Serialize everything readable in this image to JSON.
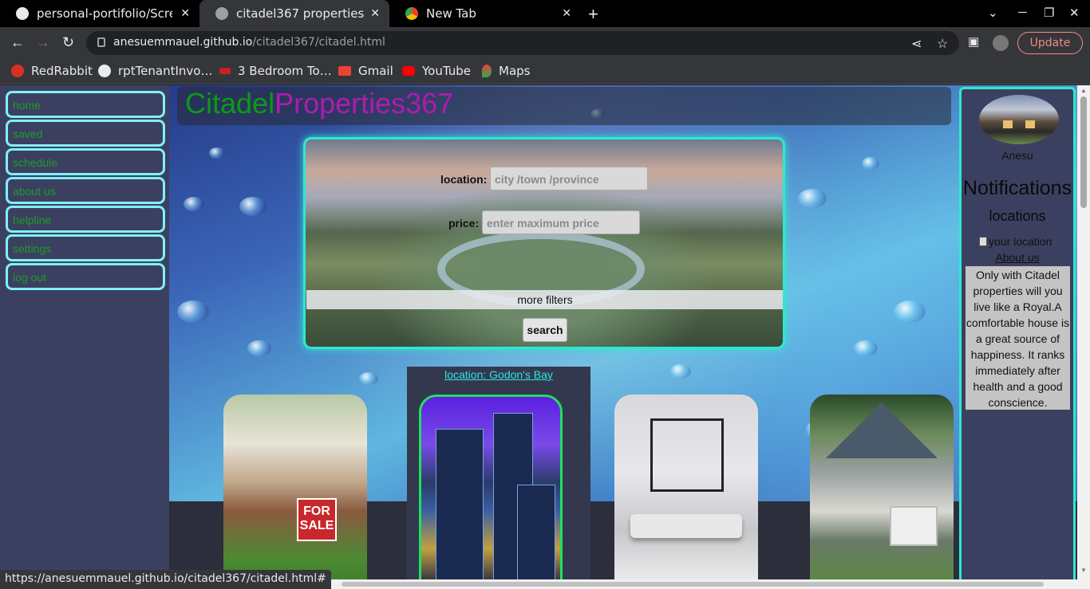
{
  "browser": {
    "tabs": [
      {
        "title": "personal-portifolio/Screen",
        "active": false,
        "icon": "github-icon"
      },
      {
        "title": "citadel367 properties",
        "active": true,
        "icon": "globe-icon"
      },
      {
        "title": "New Tab",
        "active": false,
        "icon": "chrome-icon"
      }
    ],
    "url_host": "anesuemmauel.github.io",
    "url_path": "/citadel367/citadel.html",
    "update_label": "Update",
    "bookmarks": [
      {
        "label": "RedRabbit",
        "icon": "redrabbit-icon",
        "color": "#d93025"
      },
      {
        "label": "rptTenantInvo…",
        "icon": "globe-icon",
        "color": "#e8eaed"
      },
      {
        "label": "3 Bedroom To…",
        "icon": "property-icon",
        "color": "#c5221f"
      },
      {
        "label": "Gmail",
        "icon": "gmail-icon",
        "color": "#ea4335"
      },
      {
        "label": "YouTube",
        "icon": "youtube-icon",
        "color": "#ff0000"
      },
      {
        "label": "Maps",
        "icon": "maps-icon",
        "color": "#34a853"
      }
    ],
    "status_url": "https://anesuemmauel.github.io/citadel367/citadel.html#"
  },
  "page": {
    "brand_part1": "Citadel",
    "brand_part2": "Properties367",
    "nav": [
      "home",
      "saved",
      "schedule",
      "about us",
      "helpline",
      "settings",
      "log out"
    ],
    "search": {
      "location_label": "location:",
      "location_placeholder": "city /town /province",
      "price_label": "price:",
      "price_placeholder": "enter maximum price",
      "more_filters": "more filters",
      "search_button": "search"
    },
    "featured_location": "location: Godon's Bay",
    "listings": [
      {
        "name": "for-sale-house",
        "sign": "FOR SALE"
      },
      {
        "name": "apartment-tower"
      },
      {
        "name": "interior-living-room"
      },
      {
        "name": "suburban-house"
      }
    ],
    "right_panel": {
      "user_name": "Anesu",
      "notifications_title": "Notifications",
      "locations_title": "locations",
      "image_alt": "your location",
      "about_link": "About us",
      "quote": "Only with Citadel properties will you live like a Royal.A comfortable house is a great source of happiness. It ranks immediately after health and a good conscience."
    }
  },
  "colors": {
    "accent_cyan": "#2de8d0",
    "nav_border": "#80f0f8",
    "nav_text": "#1d9b2a",
    "brand_green": "#0b9a16",
    "brand_purple": "#b01ab0",
    "update_red": "#f28b82"
  }
}
